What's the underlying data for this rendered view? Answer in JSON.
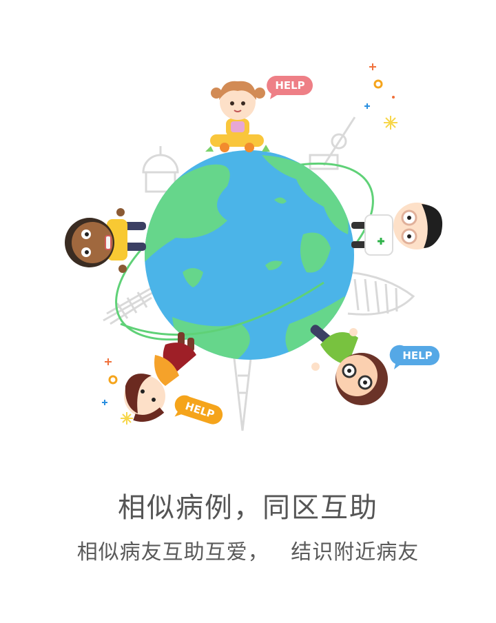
{
  "onboarding": {
    "title": "相似病例，同区互助",
    "subtitle": "相似病友互助互爱，   结识附近病友",
    "help_bubbles": [
      "HELP",
      "HELP",
      "HELP"
    ]
  },
  "colors": {
    "ocean": "#4bb4e8",
    "land": "#66d68b",
    "orbit": "#5fd177",
    "help_pink": "#ee7f86",
    "help_blue": "#55a8e6",
    "help_orange": "#f5a41b",
    "text": "#555555"
  },
  "icons": [
    "globe-icon",
    "orbit-ring",
    "speech-bubble-icon",
    "sparkle-icon"
  ]
}
